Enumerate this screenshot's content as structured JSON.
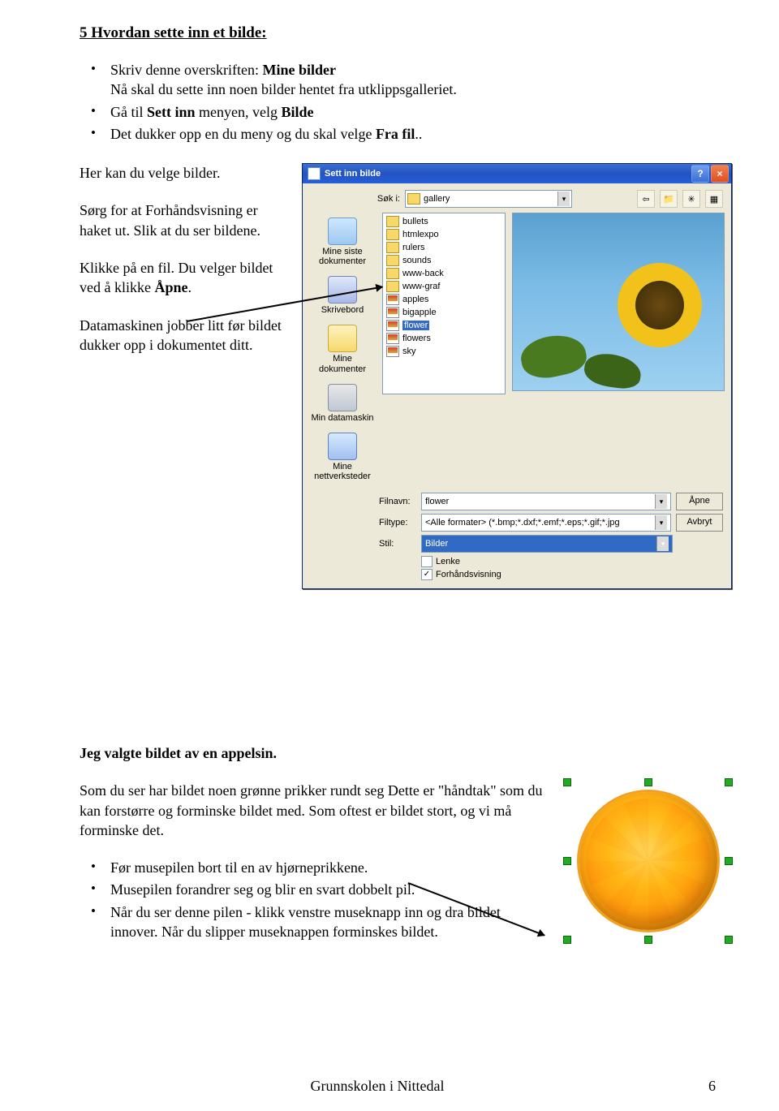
{
  "heading": "5  Hvordan sette inn et bilde:",
  "intro_bullets": [
    {
      "pre": "Skriv denne overskriften: ",
      "bold": "Mine bilder",
      "line2": "Nå skal du sette inn noen bilder hentet fra utklippsgalleriet."
    },
    {
      "pre": "Gå til ",
      "bold1": "Sett inn",
      "mid": " menyen, velg  ",
      "bold2": "Bilde"
    },
    {
      "pre": "Det dukker opp en du meny og du skal velge ",
      "bold": "Fra fil",
      "suffix": ".."
    }
  ],
  "left_paras": {
    "p1": "Her kan du velge bilder.",
    "p2": "Sørg for at Forhåndsvisning er haket ut. Slik at du ser bildene.",
    "p3_pre": "Klikke på en fil. Du velger bildet ved å klikke ",
    "p3_bold": "Åpne",
    "p3_post": ".",
    "p4": "Datamaskinen jobber litt før bildet dukker opp i dokumentet ditt."
  },
  "dialog": {
    "title": "Sett inn bilde",
    "sok_label": "Søk i:",
    "sok_value": "gallery",
    "places": [
      {
        "key": "recent",
        "label1": "Mine siste",
        "label2": "dokumenter"
      },
      {
        "key": "desktop",
        "label1": "Skrivebord",
        "label2": ""
      },
      {
        "key": "mydocs",
        "label1": "Mine",
        "label2": "dokumenter"
      },
      {
        "key": "mypc",
        "label1": "Min datamaskin",
        "label2": ""
      },
      {
        "key": "network",
        "label1": "Mine",
        "label2": "nettverksteder"
      }
    ],
    "files": [
      {
        "name": "bullets",
        "type": "folder"
      },
      {
        "name": "htmlexpo",
        "type": "folder"
      },
      {
        "name": "rulers",
        "type": "folder"
      },
      {
        "name": "sounds",
        "type": "folder"
      },
      {
        "name": "www-back",
        "type": "folder"
      },
      {
        "name": "www-graf",
        "type": "folder"
      },
      {
        "name": "apples",
        "type": "img"
      },
      {
        "name": "bigapple",
        "type": "img"
      },
      {
        "name": "flower",
        "type": "img",
        "selected": true
      },
      {
        "name": "flowers",
        "type": "img"
      },
      {
        "name": "sky",
        "type": "img"
      }
    ],
    "filnavn_label": "Filnavn:",
    "filnavn_value": "flower",
    "filtype_label": "Filtype:",
    "filtype_value": "<Alle formater> (*.bmp;*.dxf;*.emf;*.eps;*.gif;*.jpg",
    "stil_label": "Stil:",
    "stil_value": "Bilder",
    "btn_open": "Åpne",
    "btn_cancel": "Avbryt",
    "chk_lenke": "Lenke",
    "chk_preview": "Forhåndsvisning"
  },
  "orange_heading": "Jeg valgte bildet av en appelsin.",
  "orange_para1": "Som du ser har bildet noen grønne prikker rundt seg Dette er \"håndtak\" som du kan forstørre og forminske bildet med. Som oftest er bildet stort, og vi må forminske det.",
  "orange_bullets": [
    "Før musepilen bort til en av hjørneprikkene.",
    "Musepilen forandrer seg og blir en svart dobbelt pil.",
    "Når du ser denne pilen - klikk venstre museknapp inn og dra bildet innover. Når du slipper museknappen  forminskes bildet."
  ],
  "footer": {
    "text": "Grunnskolen i Nittedal",
    "page": "6"
  }
}
